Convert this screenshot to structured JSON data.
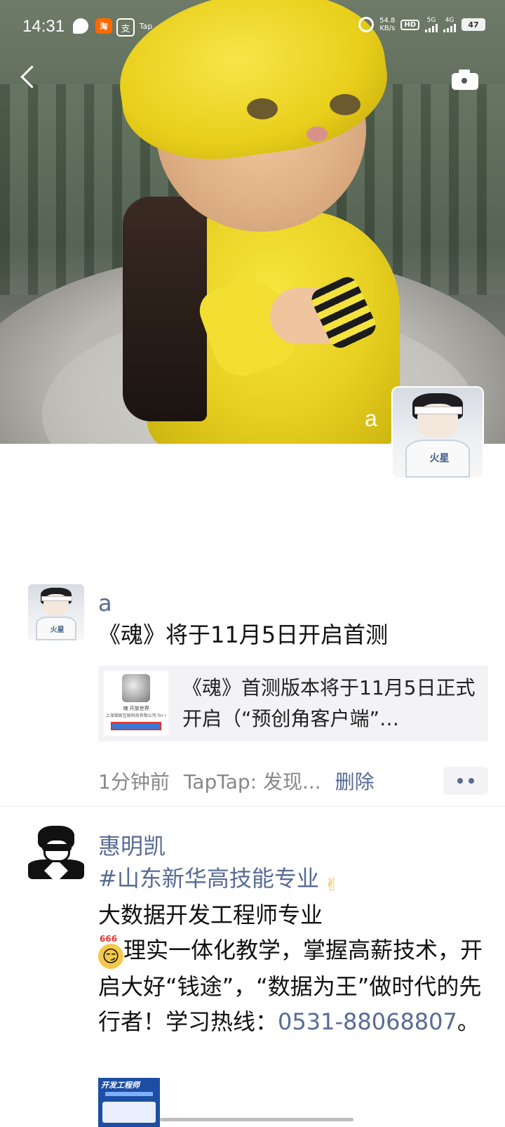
{
  "status_bar": {
    "time": "14:31",
    "tap_label": "Tap",
    "alipay_label": "支",
    "speed_value": "54.8",
    "speed_unit": "KB/s",
    "hd_label": "HD",
    "net1": "5G",
    "net2": "4G",
    "battery": "47"
  },
  "header": {
    "profile_name": "a"
  },
  "posts": [
    {
      "author": "a",
      "text": "《魂》将于11月5日开启首测",
      "link": {
        "title": "《魂》首测版本将于11月5日正式开启（“预创角客户端”…",
        "thumb_line1": "魂 开放世界",
        "thumb_line2": "上海锦娱互娱科技有限公司 for r"
      },
      "time": "1分钟前",
      "source": "TapTap: 发现...",
      "delete_label": "删除"
    },
    {
      "author": "惠明凯",
      "line1": "#山东新华高技能专业",
      "line2": "大数据开发工程师专业",
      "emoji_badge": "666",
      "line3": "理实一体化教学，掌握高薪技术，开启大好“钱途”，“数据为王”做时代的先行者！学习热线：",
      "phone": "0531-88068807",
      "line3_end": "。",
      "thumb_title": "开发工程师"
    }
  ],
  "icons": [
    "back-arrow-icon",
    "camera-icon",
    "more-icon"
  ],
  "colors": {
    "link": "#576b95",
    "meta": "#888888"
  }
}
